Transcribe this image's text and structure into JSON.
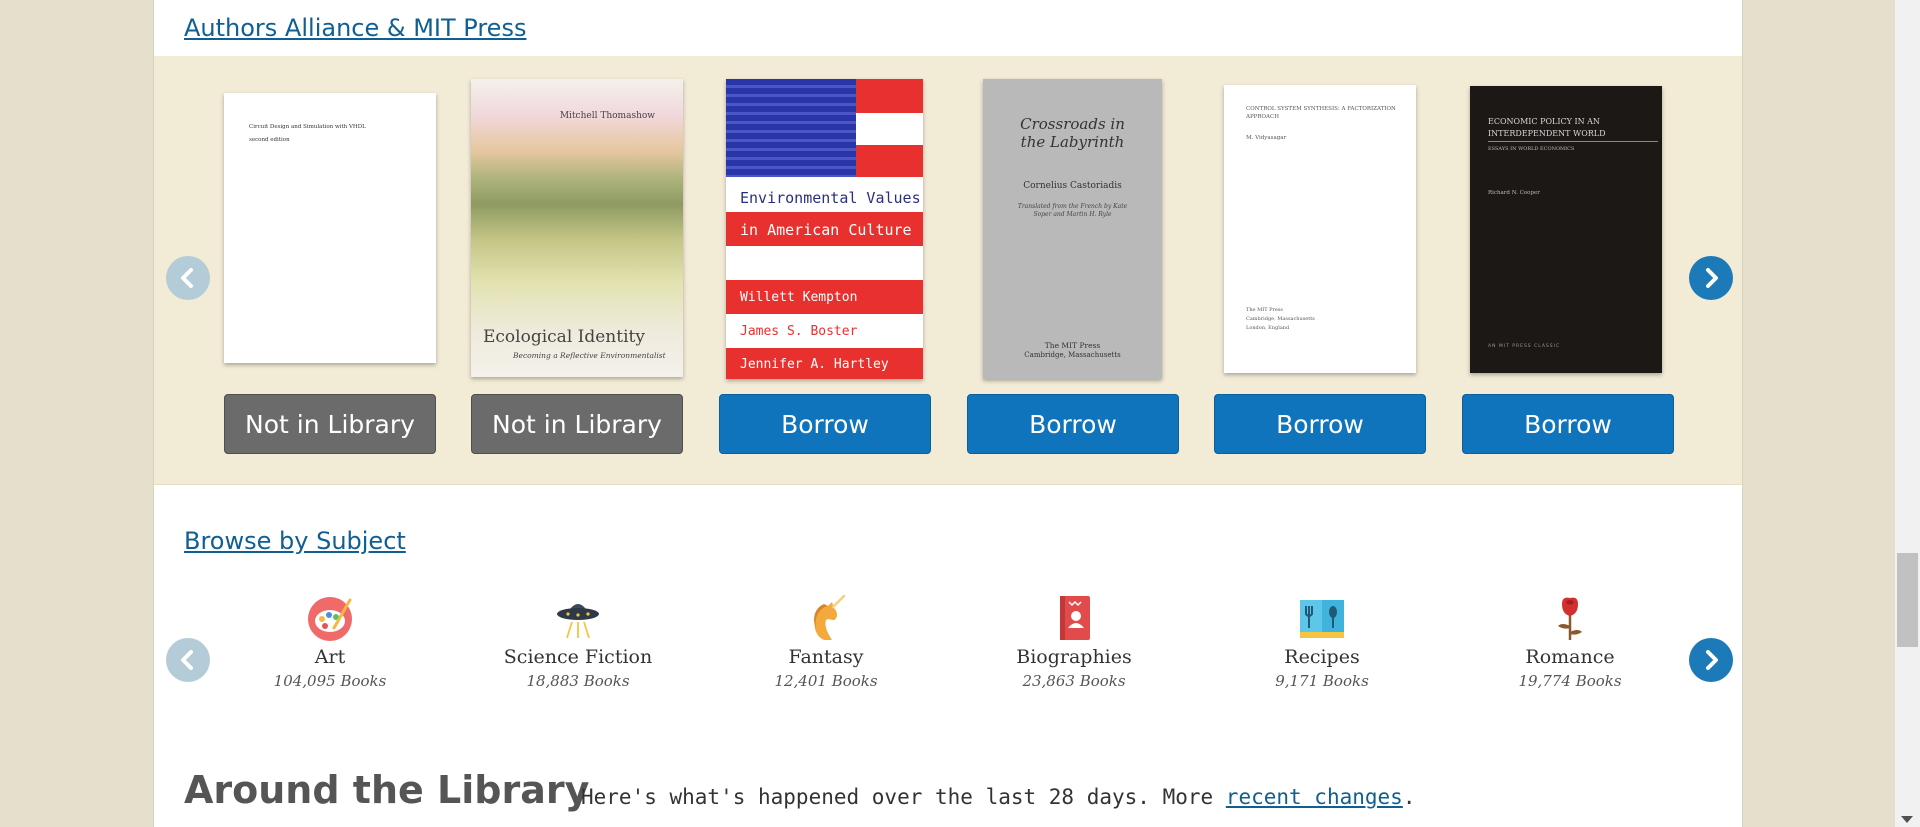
{
  "carousel": {
    "title": "Authors Alliance & MIT Press",
    "books": [
      {
        "title_lines": [
          "Circuit Design and Simulation with VHDL",
          "second edition"
        ],
        "action": "Not in Library",
        "action_color": "#6b6b6b"
      },
      {
        "author": "Mitchell Thomashow",
        "title": "Ecological Identity",
        "subtitle": "Becoming a Reflective Environmentalist",
        "action": "Not in Library",
        "action_color": "#6b6b6b"
      },
      {
        "title_lines": [
          "Environmental Values",
          "in American Culture"
        ],
        "authors": [
          "Willett Kempton",
          "James S. Boster",
          "Jennifer A. Hartley"
        ],
        "action": "Borrow",
        "action_color": "#0f74bb"
      },
      {
        "title": "Crossroads in the Labyrinth",
        "author": "Cornelius Castoriadis",
        "translator_line": "Translated from the French by Kate Soper and Martin H. Ryle",
        "publisher": "The MIT Press",
        "publisher_city": "Cambridge, Massachusetts",
        "action": "Borrow",
        "action_color": "#0f74bb"
      },
      {
        "title": "Control System Synthesis: A Factorization Approach",
        "author": "M. Vidyasagar",
        "publisher": "The MIT Press",
        "publisher_city": "Cambridge, Massachusetts",
        "publisher_country": "London, England",
        "action": "Borrow",
        "action_color": "#0f74bb"
      },
      {
        "title_lines": [
          "Economic Policy in an",
          "Interdependent World"
        ],
        "subtitle": "Essays in World Economics",
        "author": "Richard N. Cooper",
        "imprint": "An MIT Press Classic",
        "action": "Borrow",
        "action_color": "#0f74bb"
      }
    ]
  },
  "subjects": {
    "title": "Browse by Subject",
    "items": [
      {
        "name": "Art",
        "count": "104,095 Books",
        "icon": "art-palette-icon"
      },
      {
        "name": "Science Fiction",
        "count": "18,883 Books",
        "icon": "ufo-icon"
      },
      {
        "name": "Fantasy",
        "count": "12,401 Books",
        "icon": "unicorn-icon"
      },
      {
        "name": "Biographies",
        "count": "23,863 Books",
        "icon": "biography-book-icon"
      },
      {
        "name": "Recipes",
        "count": "9,171 Books",
        "icon": "recipe-book-icon"
      },
      {
        "name": "Romance",
        "count": "19,774 Books",
        "icon": "rose-icon"
      }
    ]
  },
  "around": {
    "title": "Around the Library",
    "desc_prefix": "Here's what's happened over the last 28 days. More ",
    "link": "recent changes",
    "desc_suffix": "."
  },
  "colors": {
    "link": "#0f5f95",
    "band": "#f2ebd6",
    "borrow": "#0f74bb",
    "not_in_library": "#6b6b6b",
    "arrow_active": "#1d7ab8",
    "arrow_disabled": "#b4ccd8"
  }
}
